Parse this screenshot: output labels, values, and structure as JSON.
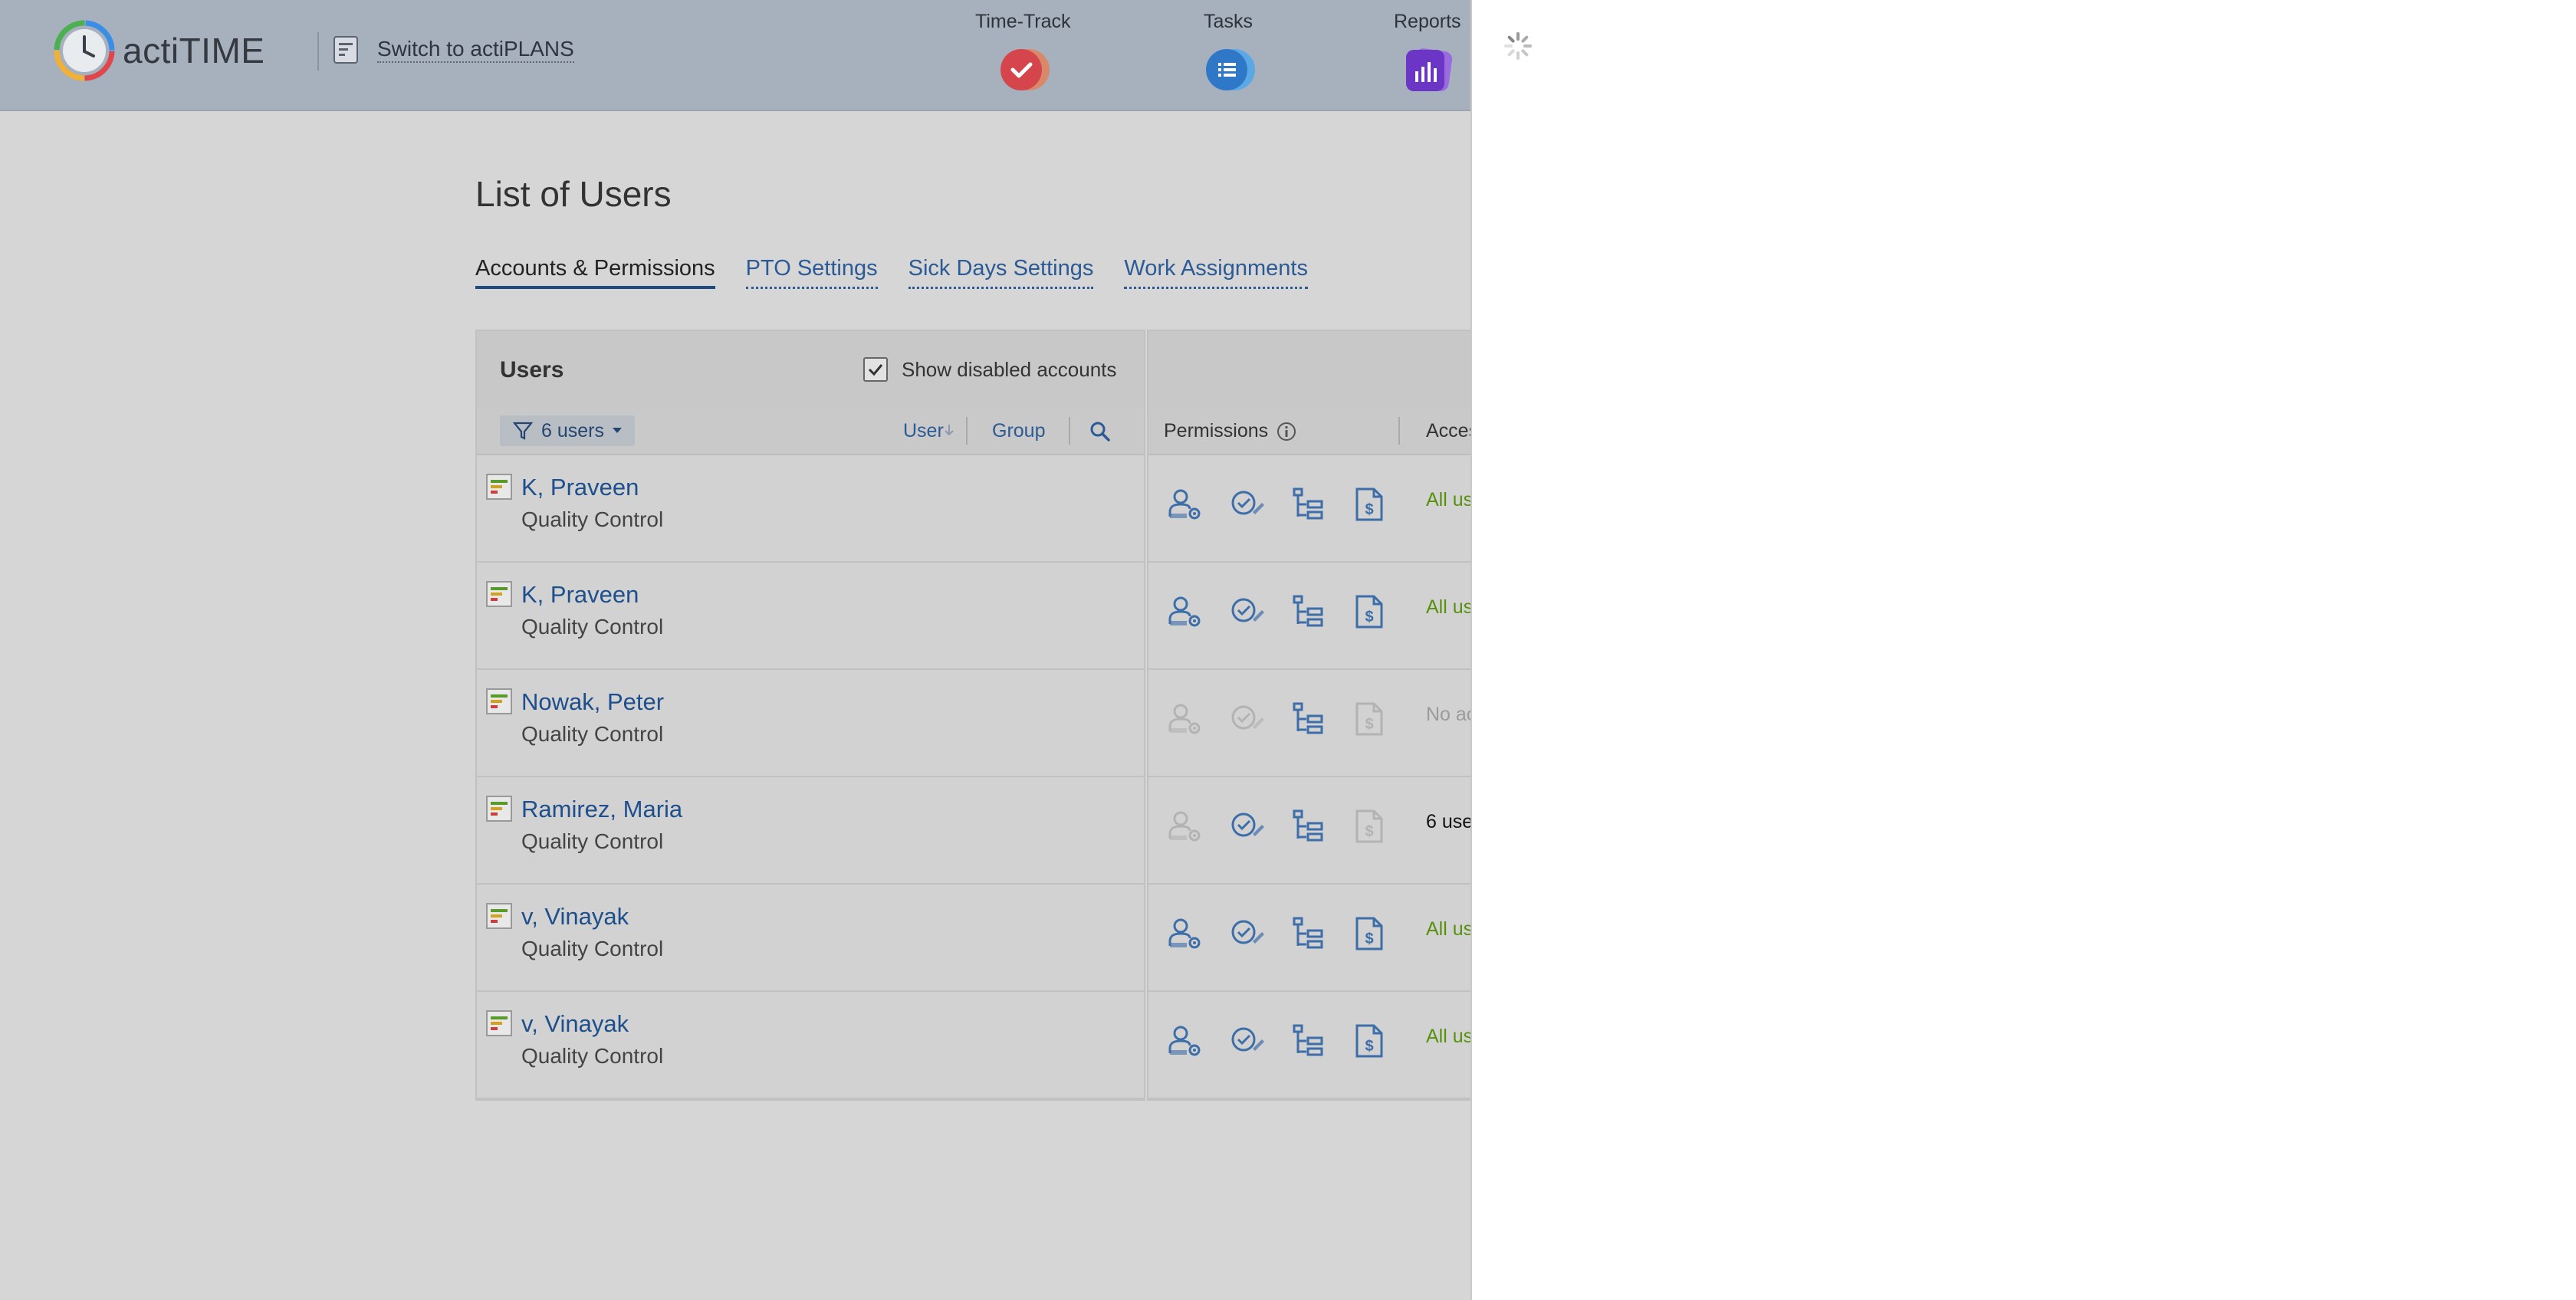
{
  "header": {
    "logo_text": "actiTIME",
    "switch_label": "Switch to actiPLANS",
    "nav": [
      {
        "label": "Time-Track",
        "icon": "checkmark-icon",
        "color": "#e0474c"
      },
      {
        "label": "Tasks",
        "icon": "list-icon",
        "color": "#3a8ee6"
      },
      {
        "label": "Reports",
        "icon": "bar-chart-icon",
        "color": "#7b3fd6"
      }
    ]
  },
  "page": {
    "title": "List of Users",
    "tabs": [
      {
        "label": "Accounts & Permissions",
        "active": true
      },
      {
        "label": "PTO Settings",
        "active": false
      },
      {
        "label": "Sick Days Settings",
        "active": false
      },
      {
        "label": "Work Assignments",
        "active": false
      }
    ]
  },
  "users_panel": {
    "title": "Users",
    "show_disabled_label": "Show disabled accounts",
    "show_disabled_checked": true,
    "filter_label": "6 users",
    "sort_user_label": "User",
    "sort_group_label": "Group"
  },
  "permissions_panel": {
    "permissions_label": "Permissions",
    "access_label": "Acces"
  },
  "users": [
    {
      "name": "K, Praveen",
      "group": "Quality Control",
      "perms": [
        true,
        true,
        true,
        true
      ],
      "access": "All us",
      "access_style": "green"
    },
    {
      "name": "K, Praveen",
      "group": "Quality Control",
      "perms": [
        true,
        true,
        true,
        true
      ],
      "access": "All us",
      "access_style": "green"
    },
    {
      "name": "Nowak, Peter",
      "group": "Quality Control",
      "perms": [
        false,
        false,
        true,
        false
      ],
      "access": "No ac",
      "access_style": "gray"
    },
    {
      "name": "Ramirez, Maria",
      "group": "Quality Control",
      "perms": [
        false,
        true,
        true,
        false
      ],
      "access": "6 use",
      "access_style": "black"
    },
    {
      "name": "v, Vinayak",
      "group": "Quality Control",
      "perms": [
        true,
        true,
        true,
        true
      ],
      "access": "All us",
      "access_style": "green"
    },
    {
      "name": "v, Vinayak",
      "group": "Quality Control",
      "perms": [
        true,
        true,
        true,
        true
      ],
      "access": "All us",
      "access_style": "green"
    }
  ]
}
